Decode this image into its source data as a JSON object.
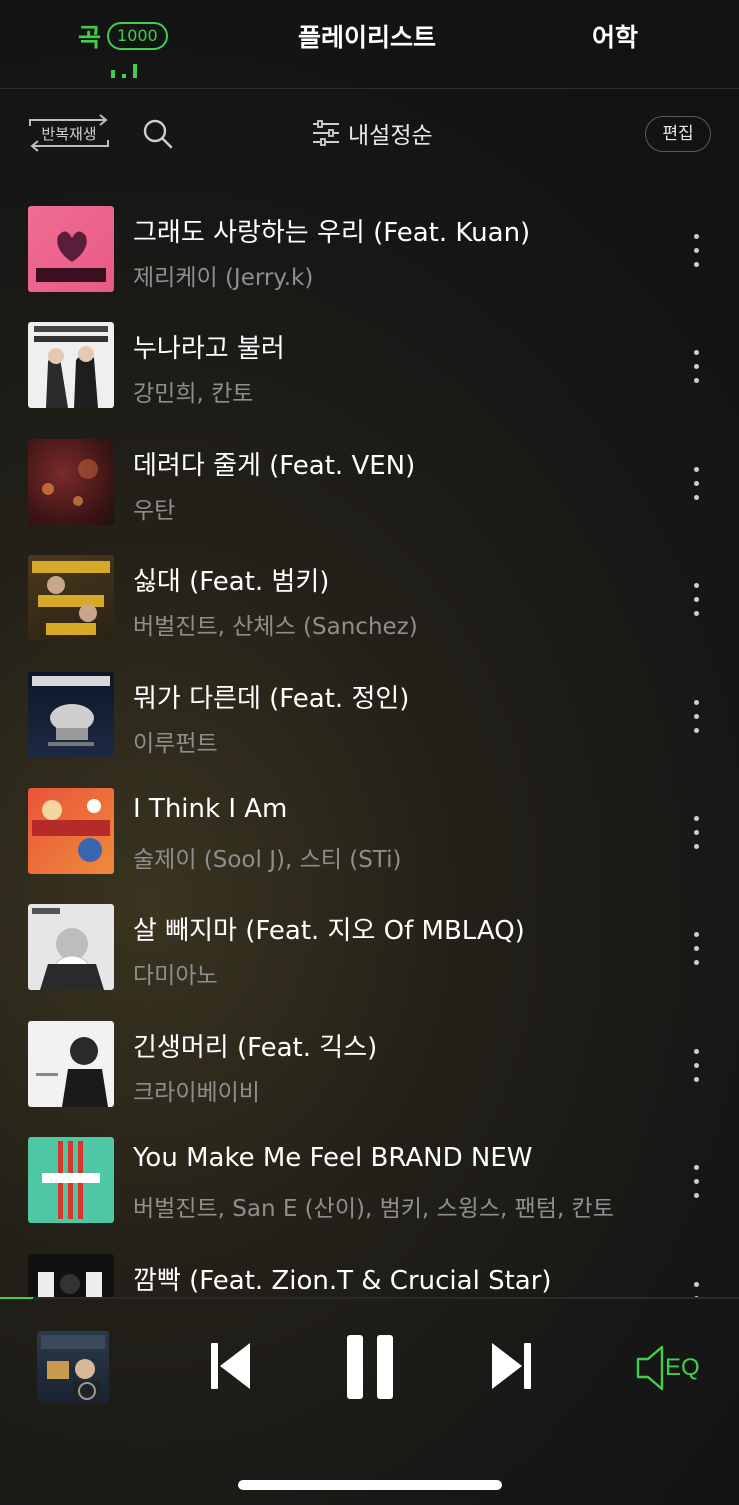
{
  "tabs": {
    "songs": "곡",
    "songs_count": "1000",
    "playlist": "플레이리스트",
    "language": "어학"
  },
  "toolbar": {
    "repeat_label": "반복재생",
    "sort_label": "내설정순",
    "edit_label": "편집"
  },
  "songs": [
    {
      "title": "그래도 사랑하는 우리 (Feat. Kuan)",
      "artist": "제리케이 (Jerry.k)"
    },
    {
      "title": "누나라고 불러",
      "artist": "강민희, 칸토"
    },
    {
      "title": "데려다 줄게 (Feat. VEN)",
      "artist": "우탄"
    },
    {
      "title": "싫대 (Feat. 범키)",
      "artist": "버벌진트, 산체스 (Sanchez)"
    },
    {
      "title": "뭐가 다른데 (Feat. 정인)",
      "artist": "이루펀트"
    },
    {
      "title": "I Think I Am",
      "artist": "술제이 (Sool J), 스티 (STi)"
    },
    {
      "title": "살 빼지마 (Feat. 지오 Of MBLAQ)",
      "artist": "다미아노"
    },
    {
      "title": "긴생머리 (Feat. 긱스)",
      "artist": "크라이베이비"
    },
    {
      "title": "You Make Me Feel BRAND NEW",
      "artist": "버벌진트, San E (산이), 범키, 스윙스, 팬텀, 칸토"
    },
    {
      "title": "깜빡 (Feat. Zion.T & Crucial Star)",
      "artist": ""
    }
  ],
  "player": {
    "progress_fraction": 0.045,
    "eq_label": "EQ"
  },
  "colors": {
    "accent": "#3ecf4c"
  },
  "icons": {
    "repeat": "repeat-icon",
    "search": "search-icon",
    "sort": "sliders-icon",
    "more": "more-vertical-icon",
    "prev": "skip-previous-icon",
    "pause": "pause-icon",
    "next": "skip-next-icon",
    "eq": "eq-speaker-icon"
  }
}
